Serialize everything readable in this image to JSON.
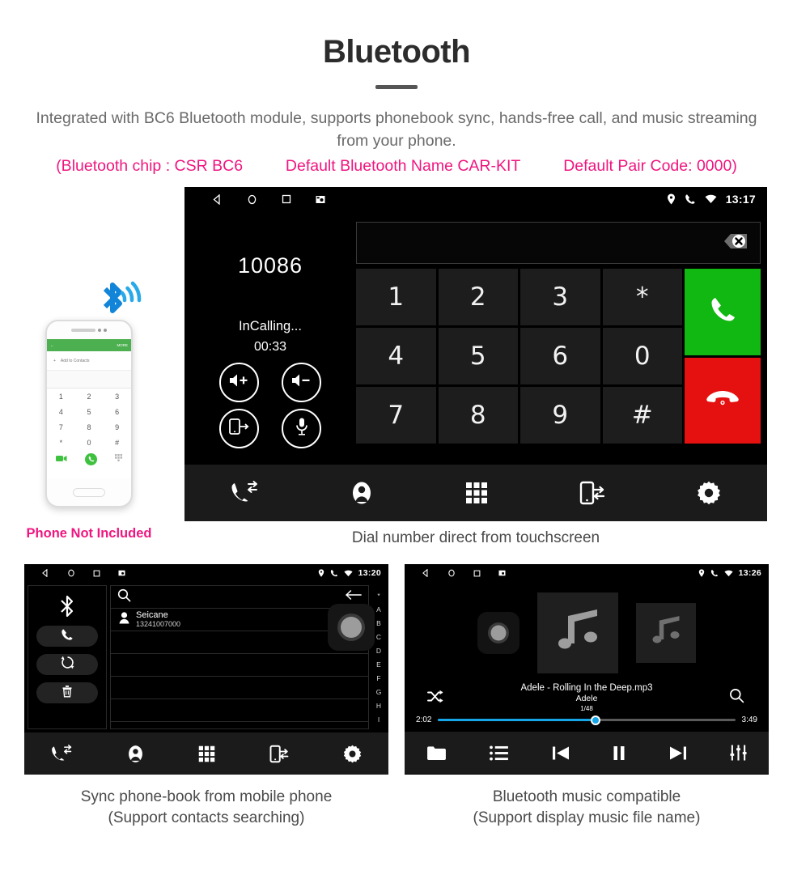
{
  "header": {
    "title": "Bluetooth",
    "intro": "Integrated with BC6 Bluetooth module, supports phonebook sync, hands-free call, and music streaming from your phone.",
    "spec_chip": "(Bluetooth chip : CSR BC6",
    "spec_name": "Default Bluetooth Name CAR-KIT",
    "spec_pair": "Default Pair Code: 0000)",
    "accent_pink": "#f0157f",
    "text_gray": "#6a6a6a"
  },
  "dial_screen": {
    "status": {
      "time": "13:17",
      "left_icons": [
        "back-icon",
        "home-icon",
        "recents-icon",
        "screenshot-icon"
      ],
      "right_icons": [
        "location-icon",
        "phone-icon",
        "wifi-icon"
      ]
    },
    "number": "10086",
    "call_state": "InCalling...",
    "call_timer": "00:33",
    "call_actions": [
      "volume-up-icon",
      "volume-down-icon",
      "transfer-to-phone-icon",
      "microphone-icon"
    ],
    "input_value": "",
    "backspace_icon": "backspace-icon",
    "keys": [
      "1",
      "2",
      "3",
      "*",
      "4",
      "5",
      "6",
      "0",
      "7",
      "8",
      "9",
      "#"
    ],
    "call_button": "call-icon",
    "hangup_button": "hangup-icon",
    "nav_items": [
      "call-log-icon",
      "contacts-icon",
      "keypad-icon",
      "phone-sync-icon",
      "settings-icon"
    ],
    "colors": {
      "call_green": "#12b812",
      "hangup_red": "#e51111",
      "key_bg": "#1d1d1d"
    }
  },
  "phone_mock": {
    "header_back": "back-arrow-icon",
    "header_more": "MORE",
    "add_contacts": "Add to Contacts",
    "keys": [
      "1",
      "2",
      "3",
      "4",
      "5",
      "6",
      "7",
      "8",
      "9",
      "*",
      "0",
      "#"
    ],
    "bottom_icons": [
      "video-call-icon",
      "call-icon",
      "keypad-icon"
    ],
    "bluetooth_icon": "bluetooth-signal-icon",
    "not_included_label": "Phone Not Included"
  },
  "captions": {
    "dial": "Dial number direct from touchscreen",
    "phonebook_line1": "Sync phone-book from mobile phone",
    "phonebook_line2": "(Support contacts searching)",
    "music_line1": "Bluetooth music compatible",
    "music_line2": "(Support display music file name)"
  },
  "phonebook_screen": {
    "status": {
      "time": "13:20"
    },
    "side_icons": [
      "bluetooth-icon",
      "call-icon",
      "sync-icon",
      "delete-icon"
    ],
    "search_icon": "search-icon",
    "back_icon": "back-arrow-icon",
    "contact": {
      "name": "Seicane",
      "number": "13241007000",
      "avatar": "contact-avatar-icon"
    },
    "index_letters": [
      "*",
      "A",
      "B",
      "C",
      "D",
      "E",
      "F",
      "G",
      "H",
      "I"
    ],
    "nav_items": [
      "call-log-icon",
      "contacts-icon",
      "keypad-icon",
      "phone-sync-icon",
      "settings-icon"
    ]
  },
  "music_screen": {
    "status": {
      "time": "13:26"
    },
    "track_title": "Adele - Rolling In the Deep.mp3",
    "artist": "Adele",
    "track_count": "1/48",
    "elapsed": "2:02",
    "duration": "3:49",
    "progress_percent": 53,
    "progress_color": "#16a6e8",
    "shuffle_icon": "shuffle-icon",
    "search_icon": "search-icon",
    "album_art_icon": "music-note-icon",
    "controls": [
      "folder-icon",
      "playlist-icon",
      "previous-icon",
      "pause-icon",
      "next-icon",
      "equalizer-icon"
    ]
  }
}
